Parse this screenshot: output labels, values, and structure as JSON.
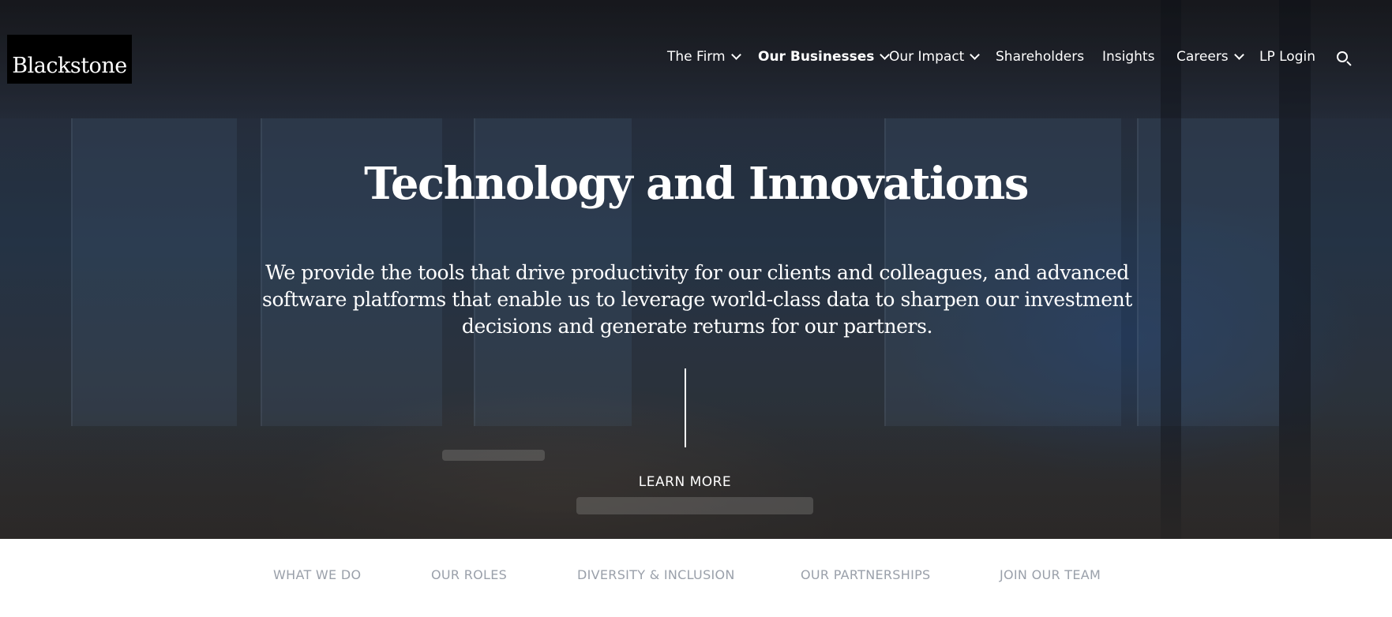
{
  "logo": {
    "text": "Blackstone"
  },
  "nav": {
    "items": [
      {
        "label": "The Firm",
        "dropdown": true
      },
      {
        "label": "Our Businesses",
        "dropdown": true,
        "active": true
      },
      {
        "label": "Our Impact",
        "dropdown": true
      },
      {
        "label": "Shareholders",
        "dropdown": false
      },
      {
        "label": "Insights",
        "dropdown": false
      },
      {
        "label": "Careers",
        "dropdown": true
      },
      {
        "label": "LP Login",
        "dropdown": false
      }
    ],
    "search_icon": "search-icon"
  },
  "hero": {
    "title": "Technology and Innovations",
    "description": "We provide the tools that drive productivity for our clients and colleagues, and advanced software platforms that enable us to leverage world-class data to sharpen our investment decisions and generate returns for our partners.",
    "cta": "LEARN MORE"
  },
  "subnav": {
    "items": [
      "WHAT WE DO",
      "OUR ROLES",
      "DIVERSITY & INCLUSION",
      "OUR PARTNERSHIPS",
      "JOIN OUR TEAM"
    ]
  },
  "colors": {
    "subnav_text": "#9aa0aa",
    "logo_bg": "#000000",
    "hero_text": "#ffffff"
  }
}
